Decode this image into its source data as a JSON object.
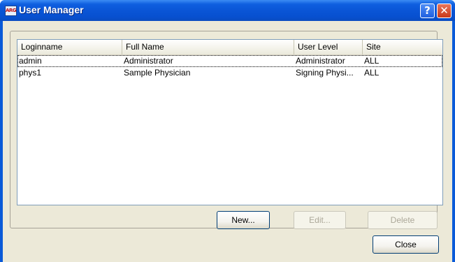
{
  "window": {
    "title": "User Manager",
    "app_icon_text": "ARG",
    "help_glyph": "?",
    "close_glyph": "✕"
  },
  "list": {
    "columns": [
      "Loginname",
      "Full Name",
      "User Level",
      "Site"
    ],
    "rows": [
      {
        "loginname": "admin",
        "full_name": "Administrator",
        "user_level": "Administrator",
        "site": "ALL",
        "selected": true
      },
      {
        "loginname": "phys1",
        "full_name": "Sample Physician",
        "user_level": "Signing Physi...",
        "site": "ALL",
        "selected": false
      }
    ]
  },
  "buttons": {
    "new_label": "New...",
    "edit_label": "Edit...",
    "delete_label": "Delete",
    "close_label": "Close"
  },
  "icons": {
    "app": "arg-app-icon",
    "help": "help-icon",
    "close": "close-icon"
  }
}
